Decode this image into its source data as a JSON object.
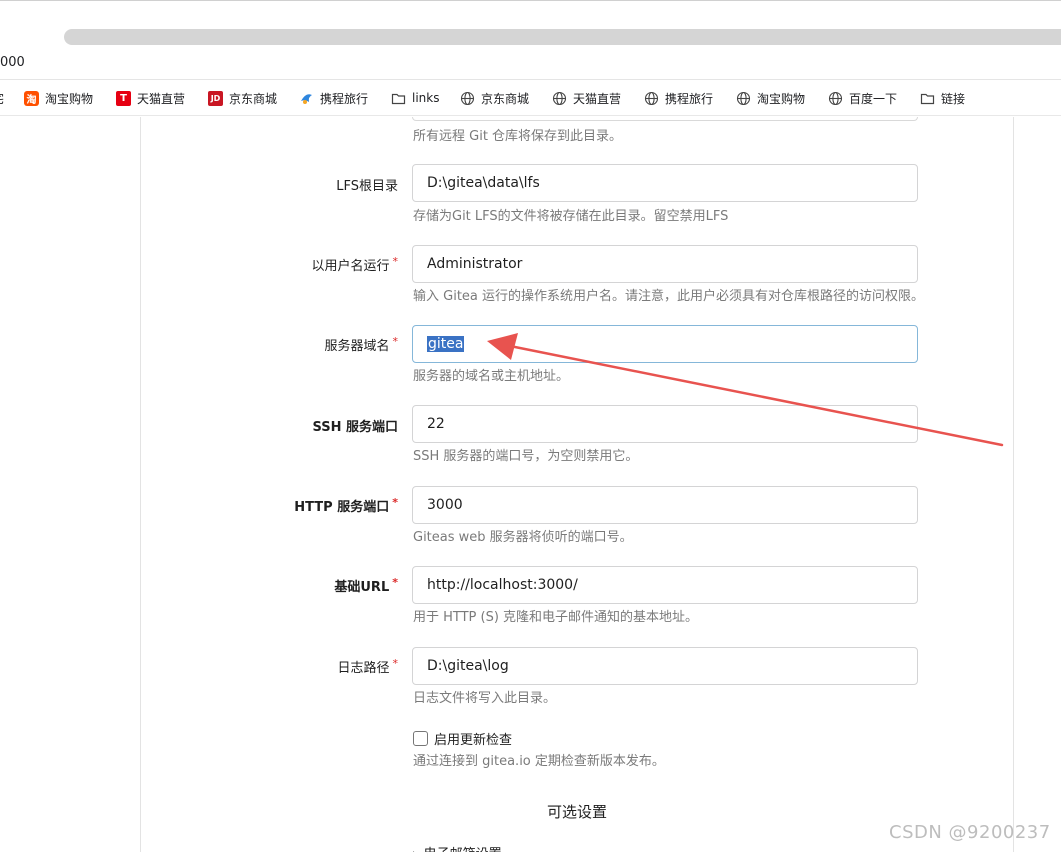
{
  "browser": {
    "address_fragment": "000",
    "bookmarks": [
      {
        "label": "淘宝购物",
        "icon": "taobao-icon"
      },
      {
        "label": "天猫直营",
        "icon": "tmall-icon"
      },
      {
        "label": "京东商城",
        "icon": "jd-icon"
      },
      {
        "label": "携程旅行",
        "icon": "ctrip-icon"
      },
      {
        "label": "links",
        "icon": "folder-icon"
      },
      {
        "label": "京东商城",
        "icon": "globe-icon"
      },
      {
        "label": "天猫直营",
        "icon": "globe-icon"
      },
      {
        "label": "携程旅行",
        "icon": "globe-icon"
      },
      {
        "label": "淘宝购物",
        "icon": "globe-icon"
      },
      {
        "label": "百度一下",
        "icon": "globe-icon"
      },
      {
        "label": "链接",
        "icon": "folder-icon"
      }
    ],
    "bookmark_edge_fragment": "宅"
  },
  "form": {
    "repo_root_help": "所有远程 Git 仓库将保存到此目录。",
    "lfs": {
      "label": "LFS根目录",
      "value": "D:\\gitea\\data\\lfs",
      "help": "存储为Git LFS的文件将被存储在此目录。留空禁用LFS"
    },
    "run_user": {
      "label": "以用户名运行",
      "required": "*",
      "value": "Administrator",
      "help": "输入 Gitea 运行的操作系统用户名。请注意，此用户必须具有对仓库根路径的访问权限。"
    },
    "domain": {
      "label": "服务器域名",
      "required": "*",
      "value": "gitea",
      "help": "服务器的域名或主机地址。"
    },
    "ssh_port": {
      "label": "SSH 服务端口",
      "value": "22",
      "help": "SSH 服务器的端口号，为空则禁用它。"
    },
    "http_port": {
      "label": "HTTP 服务端口",
      "required": "*",
      "value": "3000",
      "help": "Giteas web 服务器将侦听的端口号。"
    },
    "base_url": {
      "label": "基础URL",
      "required": "*",
      "value": "http://localhost:3000/",
      "help": "用于 HTTP (S) 克隆和电子邮件通知的基本地址。"
    },
    "log_path": {
      "label": "日志路径",
      "required": "*",
      "value": "D:\\gitea\\log",
      "help": "日志文件将写入此目录。"
    },
    "update_check": {
      "label": "启用更新检查",
      "help": "通过连接到 gitea.io 定期检查新版本发布。"
    },
    "optional_title": "可选设置",
    "email_settings": "▸ 电子邮箱设置"
  },
  "annotation": {
    "color": "#e8534f"
  },
  "watermark": "CSDN @9200237"
}
